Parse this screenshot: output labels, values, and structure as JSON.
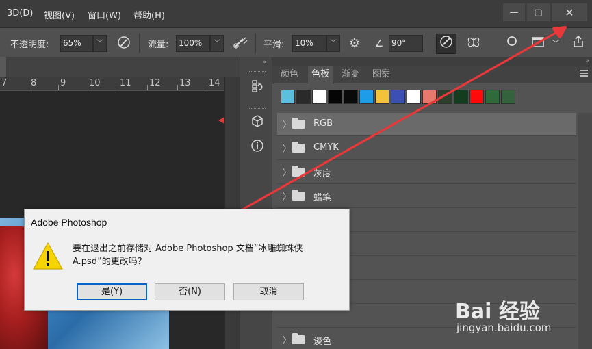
{
  "menu": {
    "items": [
      "3D(D)",
      "视图(V)",
      "窗口(W)",
      "帮助(H)"
    ]
  },
  "window_controls": {
    "minimize": "—",
    "maximize": "▢",
    "close": "✕"
  },
  "options": {
    "opacity_label": "不透明度:",
    "opacity_value": "65%",
    "flow_label": "流量:",
    "flow_value": "100%",
    "smooth_label": "平滑:",
    "smooth_value": "10%",
    "angle_value": "90°"
  },
  "ruler": {
    "numbers": [
      "7",
      "8",
      "9",
      "10",
      "11",
      "12",
      "13",
      "14"
    ]
  },
  "panel": {
    "tabs": [
      "颜色",
      "色板",
      "渐变",
      "图案"
    ],
    "active_tab": "色板",
    "swatches": [
      "#5bc0dc",
      "#2a2a2a",
      "#ffffff",
      "#050505",
      "#0a0a0a",
      "#1e9ce8",
      "#f2c33a",
      "#3c4fb4",
      "#ffffff",
      "#e6786c",
      "#2b3f2b",
      "#143c1e",
      "#ff0a0a",
      "#2f6a3a",
      "#34623c"
    ],
    "groups": [
      "RGB",
      "CMYK",
      "灰度",
      "蜡笔",
      "",
      "",
      "",
      "",
      "淡色"
    ]
  },
  "dialog": {
    "title": "Adobe Photoshop",
    "message": "要在退出之前存储对 Adobe Photoshop 文档“冰雕蜘蛛侠A.psd”的更改吗？",
    "buttons": {
      "yes": "是(Y)",
      "no": "否(N)",
      "cancel": "取消"
    }
  },
  "watermark": {
    "brand": "Bai 经验",
    "url": "jingyan.baidu.com"
  },
  "colors": {
    "annotation_arrow": "#e8383a",
    "warning": "#f5d400"
  }
}
